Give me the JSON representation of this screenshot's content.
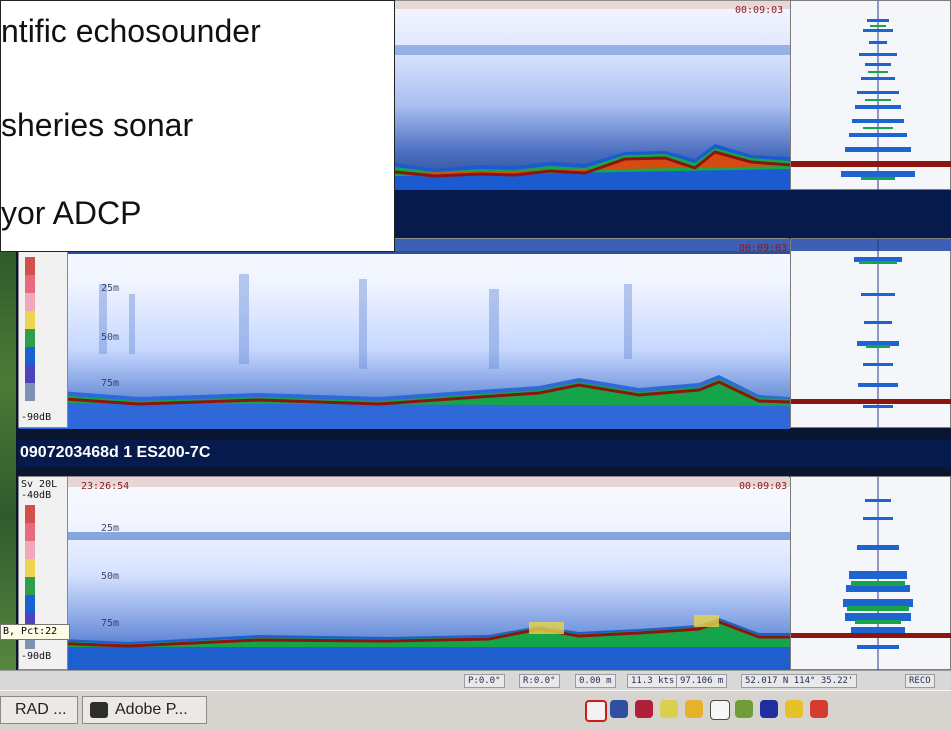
{
  "colors": {
    "background": "#0a1530",
    "panel": "#f1f3f7",
    "title_bar": "#071a4c",
    "bottom_line": "#8d1510",
    "callout_bg": "#ffffff"
  },
  "callout": {
    "lines": [
      "ntific echosounder",
      "sheries sonar",
      "yor ADCP"
    ]
  },
  "echograms": [
    {
      "timecode": "00:09:03",
      "depth_labels": []
    },
    {
      "timecode": "00:09:03",
      "depth_labels": [
        "25m",
        "50m",
        "75m"
      ],
      "scale_min": "-90dB"
    },
    {
      "timecode": "00:09:03",
      "timestamp": "23:26:54",
      "depth_labels": [
        "25m",
        "50m",
        "75m"
      ],
      "scale_top": "Sv 20L",
      "scale_max": "-40dB",
      "scale_min": "-90dB"
    }
  ],
  "bars": {
    "title": "0907203468d 1 ES200-7C"
  },
  "overlay": {
    "label": "B, Pct:22"
  },
  "status": {
    "items": [
      "P:0.0°",
      "R:0.0°",
      "0.00 m",
      "11.3 kts",
      "97.106 m",
      "52.017 N  114° 35.22'",
      "RECO"
    ]
  },
  "taskbar": {
    "items": [
      {
        "label": "RAD ..."
      },
      {
        "label": "Adobe P..."
      }
    ],
    "tray_icons": [
      "search-icon",
      "tools-icon",
      "bucket-icon",
      "speaker-icon",
      "monitor-icon",
      "disc-icon",
      "chart-icon",
      "ev-icon",
      "folder-icon",
      "stop-icon"
    ]
  }
}
